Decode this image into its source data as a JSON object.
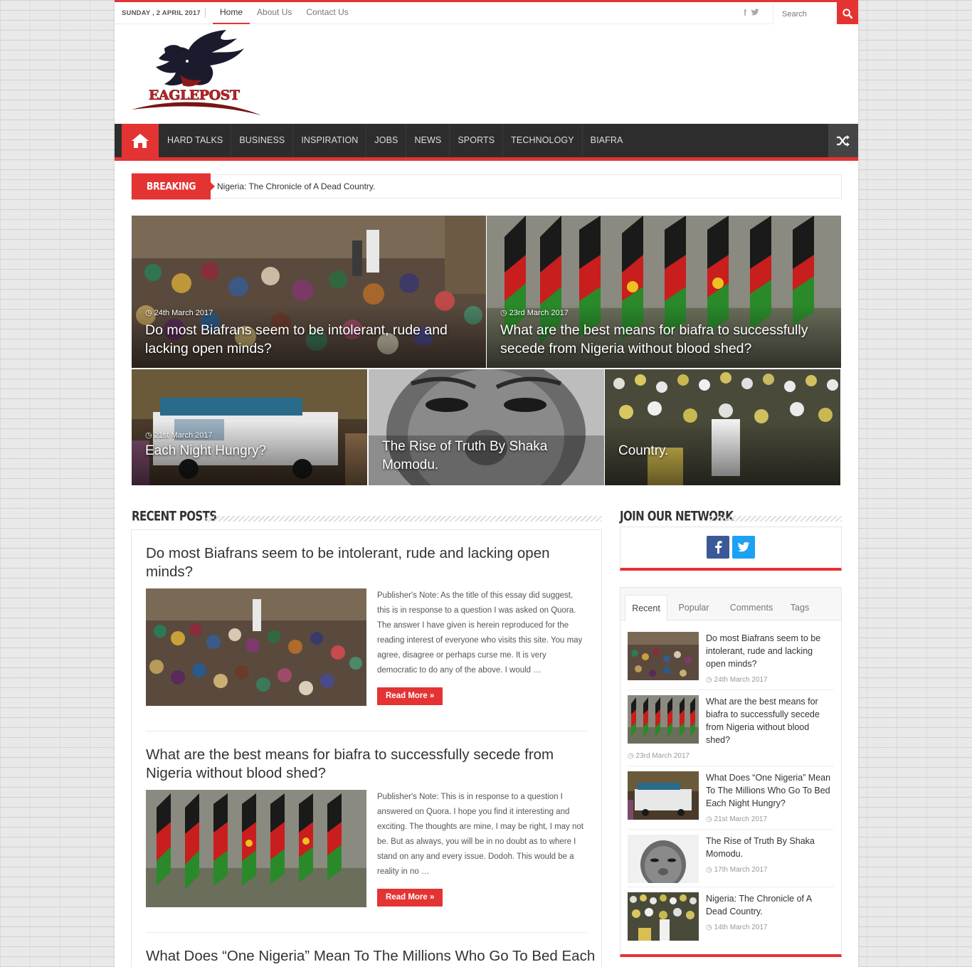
{
  "topbar": {
    "date": "SUNDAY , 2 APRIL 2017",
    "links": [
      {
        "label": "Home",
        "active": true
      },
      {
        "label": "About Us",
        "active": false
      },
      {
        "label": "Contact Us",
        "active": false
      }
    ],
    "social": [
      "f",
      "t"
    ],
    "search_placeholder": "Search"
  },
  "logo": {
    "text": "EAGLEPOST"
  },
  "nav": {
    "home_icon": "home-icon",
    "items": [
      "HARD TALKS",
      "BUSINESS",
      "INSPIRATION",
      "JOBS",
      "NEWS",
      "SPORTS",
      "TECHNOLOGY",
      "BIAFRA"
    ],
    "shuffle_icon": "shuffle-icon"
  },
  "breaking": {
    "label": "BREAKING NEWS",
    "headline": "Nigeria: The Chronicle of A Dead Country."
  },
  "slider": {
    "large": [
      {
        "date": "24th March 2017",
        "title": "Do most Biafrans seem to be intolerant, rude and lacking open minds?"
      },
      {
        "date": "23rd March 2017",
        "title": "What are the best means for biafra to successfully secede from Nigeria without blood shed?"
      }
    ],
    "small": [
      {
        "date": "21st March 2017",
        "title": "Each Night Hungry?"
      },
      {
        "date": "",
        "title": "The Rise of Truth By Shaka Momodu."
      },
      {
        "date": "",
        "title": "Country."
      }
    ]
  },
  "recent_posts": {
    "heading": "RECENT POSTS",
    "read_more": "Read More »",
    "posts": [
      {
        "title": "Do most Biafrans seem to be intolerant, rude and lacking open minds?",
        "excerpt": "Publisher's Note: As the title of this essay did suggest, this is in response to a question I was asked on Quora. The answer I have given is herein reproduced for the reading interest of everyone who visits this site. You may agree, disagree or perhaps curse me. It is very democratic to do any of the above. I would …"
      },
      {
        "title": "What are the best means for biafra to successfully secede from Nigeria without blood shed?",
        "excerpt": "Publisher's Note: This is in response to a question I answered on Quora. I hope you find it interesting and exciting. The thoughts are mine, I may be right, I may not be. But as always, you will be in no doubt as to where I stand on any and every issue.  Dodoh.  This would be a reality in no …"
      },
      {
        "title": "What Does “One Nigeria” Mean To The Millions Who Go To Bed Each",
        "excerpt": ""
      }
    ]
  },
  "sidebar": {
    "network_heading": "JOIN OUR NETWORK",
    "tabs": [
      "Recent",
      "Popular",
      "Comments",
      "Tags"
    ],
    "items": [
      {
        "title": "Do most Biafrans seem to be intolerant, rude and lacking open minds?",
        "date": "24th March 2017"
      },
      {
        "title": "What are the best means for biafra to successfully secede from Nigeria without blood shed?",
        "date": "23rd March 2017"
      },
      {
        "title": "What Does “One Nigeria” Mean To The Millions Who Go To Bed Each Night Hungry?",
        "date": "21st March 2017"
      },
      {
        "title": "The Rise of Truth By Shaka Momodu.",
        "date": "17th March 2017"
      },
      {
        "title": "Nigeria: The Chronicle of A Dead Country.",
        "date": "14th March 2017"
      }
    ]
  },
  "colors": {
    "accent": "#e43333",
    "nav_bg": "#2d2d2d",
    "facebook": "#3b5998",
    "twitter": "#1da1f2"
  }
}
